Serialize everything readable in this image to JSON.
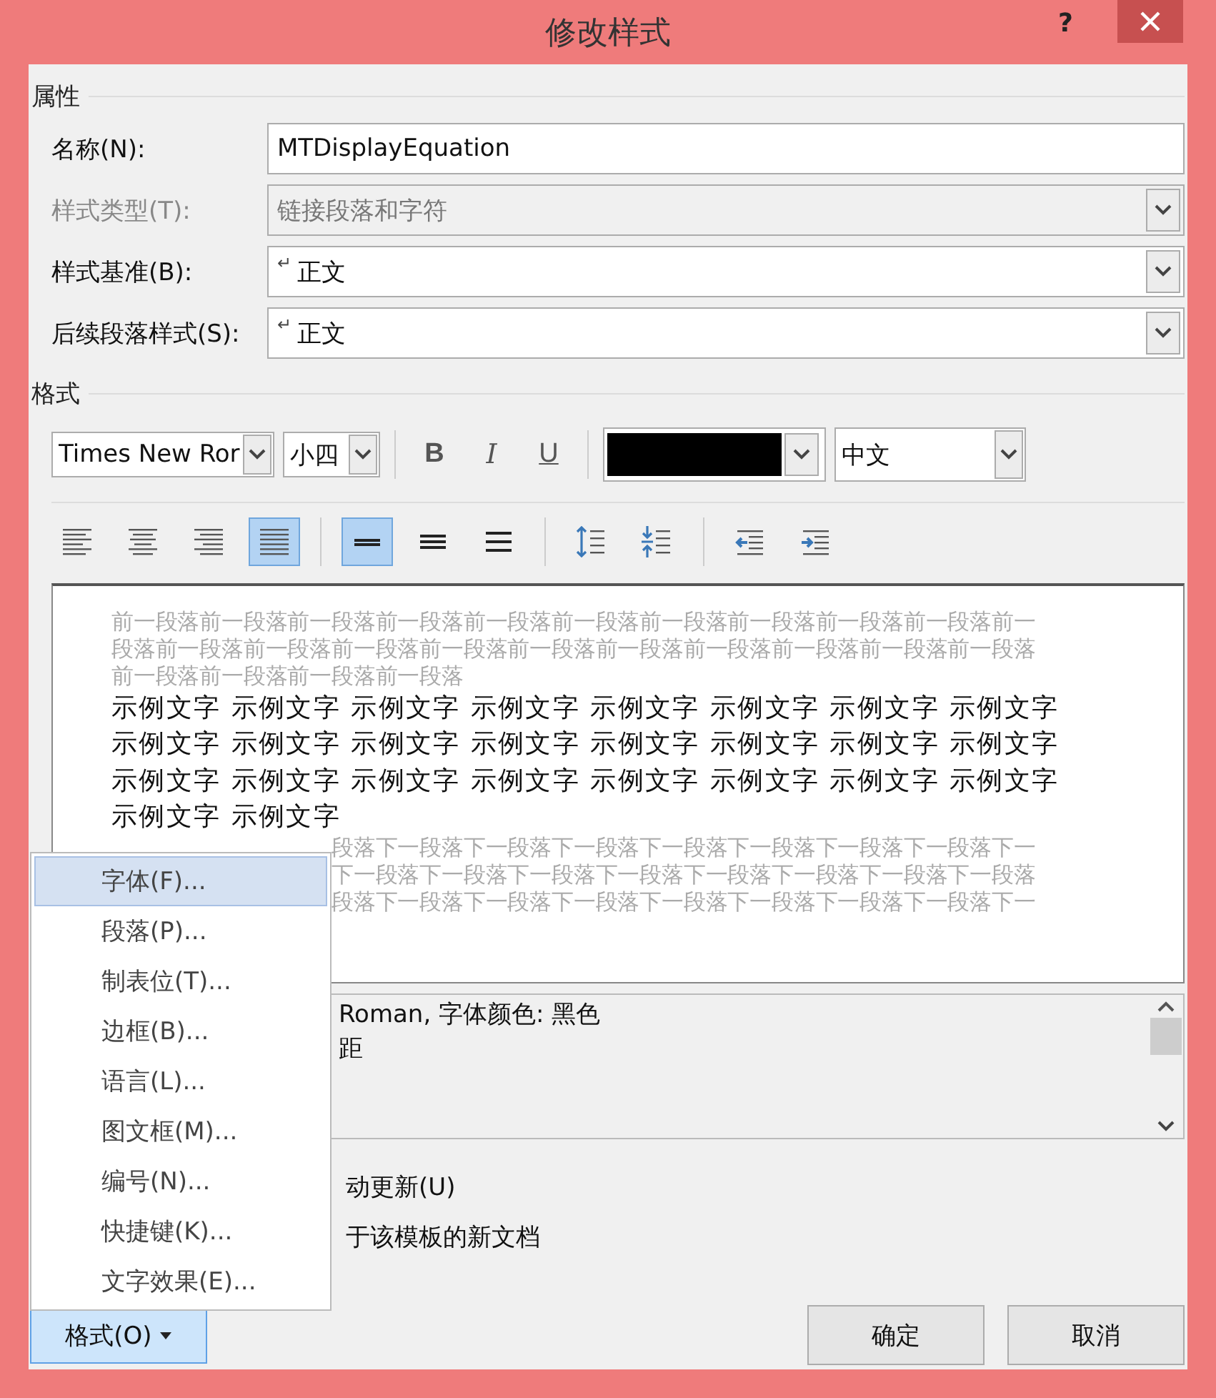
{
  "window": {
    "title": "修改样式",
    "help": "?"
  },
  "properties": {
    "heading": "属性",
    "fields": [
      {
        "label": "名称(N):",
        "value": "MTDisplayEquation",
        "kind": "text",
        "disabled": false
      },
      {
        "label": "样式类型(T):",
        "value": "链接段落和字符",
        "kind": "dropdown",
        "disabled": true
      },
      {
        "label": "样式基准(B):",
        "mark": "↵",
        "value": "正文",
        "kind": "dropdown",
        "disabled": false
      },
      {
        "label": "后续段落样式(S):",
        "mark": "↵",
        "value": "正文",
        "kind": "dropdown",
        "disabled": false
      }
    ]
  },
  "format": {
    "heading": "格式",
    "font": "Times New Ror",
    "size": "小四",
    "bold": "B",
    "italic": "I",
    "underline": "U",
    "font_color": {
      "color": "#000000"
    },
    "script": "中文",
    "alignment": [
      {
        "kind": "left",
        "selected": false
      },
      {
        "kind": "center",
        "selected": false
      },
      {
        "kind": "right",
        "selected": false
      },
      {
        "kind": "justify",
        "selected": true
      }
    ],
    "line_spacing": [
      {
        "kind": "single",
        "selected": true
      },
      {
        "kind": "one-half",
        "selected": false
      },
      {
        "kind": "double",
        "selected": false
      }
    ],
    "paragraph_spacing": [
      {
        "kind": "increase",
        "selected": false
      },
      {
        "kind": "decrease",
        "selected": false
      }
    ],
    "indent": [
      {
        "kind": "decrease",
        "selected": false
      },
      {
        "kind": "increase",
        "selected": false
      }
    ]
  },
  "preview": {
    "before_lines": [
      "前一段落前一段落前一段落前一段落前一段落前一段落前一段落前一段落前一段落前一段落前一",
      "段落前一段落前一段落前一段落前一段落前一段落前一段落前一段落前一段落前一段落前一段落",
      "前一段落前一段落前一段落前一段落"
    ],
    "sample_lines": [
      "示例文字 示例文字 示例文字 示例文字 示例文字 示例文字 示例文字 示例文字",
      "示例文字 示例文字 示例文字 示例文字 示例文字 示例文字 示例文字 示例文字",
      "示例文字 示例文字 示例文字 示例文字 示例文字 示例文字 示例文字 示例文字",
      "示例文字 示例文字"
    ],
    "after_lines": [
      "段落下一段落下一段落下一段落下一段落下一段落下一段落下一段落下一",
      "下一段落下一段落下一段落下一段落下一段落下一段落下一段落下一段落",
      "段落下一段落下一段落下一段落下一段落下一段落下一段落下一段落下一"
    ]
  },
  "description": {
    "lines": [
      "Roman, 字体颜色: 黑色",
      "距"
    ]
  },
  "options": [
    {
      "label": "动更新(U)"
    },
    {
      "label": "于该模板的新文档"
    }
  ],
  "menu": {
    "items": [
      {
        "label": "字体(F)...",
        "selected": true
      },
      {
        "label": "段落(P)...",
        "selected": false
      },
      {
        "label": "制表位(T)...",
        "selected": false
      },
      {
        "label": "边框(B)...",
        "selected": false
      },
      {
        "label": "语言(L)...",
        "selected": false
      },
      {
        "label": "图文框(M)...",
        "selected": false
      },
      {
        "label": "编号(N)...",
        "selected": false
      },
      {
        "label": "快捷键(K)...",
        "selected": false
      },
      {
        "label": "文字效果(E)...",
        "selected": false
      }
    ]
  },
  "buttons": {
    "format": {
      "label": "格式(O)",
      "expanded": true
    },
    "ok": "确定",
    "cancel": "取消"
  }
}
